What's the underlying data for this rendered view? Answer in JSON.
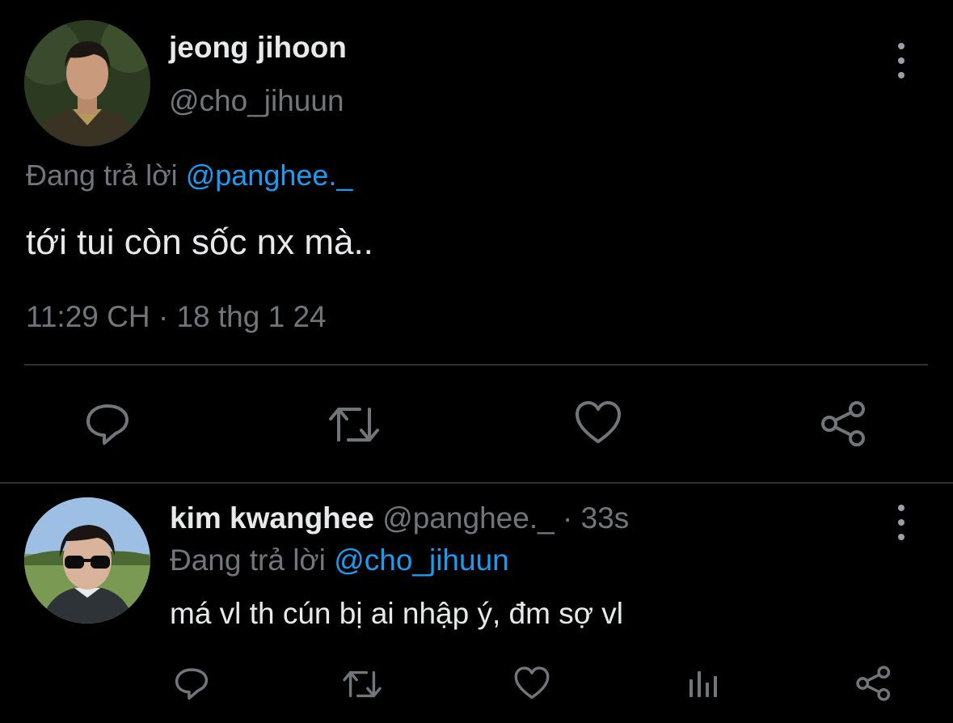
{
  "main_tweet": {
    "author_name": "jeong jihoon",
    "author_handle": "@cho_jihuun",
    "replying_prefix": "Đang trả lời",
    "replying_to": "@panghee._",
    "text": "tới tui còn sốc nx mà..",
    "time": "11:29 CH",
    "separator": "·",
    "date": "18 thg 1 24",
    "actions": {
      "reply_icon": "reply-icon",
      "retweet_icon": "retweet-icon",
      "like_icon": "heart-icon",
      "share_icon": "share-icon"
    }
  },
  "reply_tweet": {
    "author_name": "kim kwanghee",
    "author_handle": "@panghee._",
    "separator": "·",
    "age": "33s",
    "replying_prefix": "Đang trả lời",
    "replying_to": "@cho_jihuun",
    "text": "má vl th cún bị ai nhập ý, đm sợ vl",
    "actions": {
      "reply_icon": "reply-icon",
      "retweet_icon": "retweet-icon",
      "like_icon": "heart-icon",
      "analytics_icon": "analytics-icon",
      "share_icon": "share-icon"
    }
  },
  "colors": {
    "background": "#000000",
    "text_primary": "#e7e9ea",
    "text_secondary": "#71767b",
    "accent": "#1d9bf0",
    "divider": "#2f3336"
  }
}
